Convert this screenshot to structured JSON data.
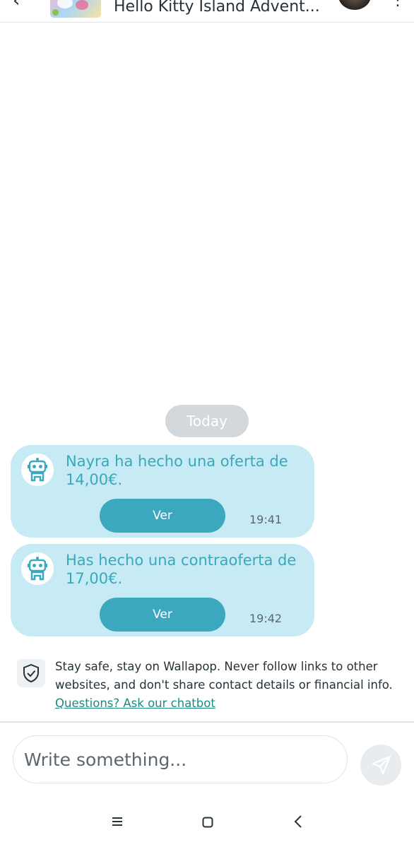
{
  "header": {
    "back_icon": "back-arrow-icon",
    "title": "Hello Kitty Island Advent...",
    "more_icon": "more-vertical-icon"
  },
  "chat": {
    "date_label": "Today",
    "messages": [
      {
        "text": "Nayra ha hecho una oferta de 14,00€.",
        "button_label": "Ver",
        "time": "19:41",
        "icon": "robot-icon"
      },
      {
        "text": "Has hecho una contraoferta de 17,00€.",
        "button_label": "Ver",
        "time": "19:42",
        "icon": "robot-icon"
      }
    ]
  },
  "safety": {
    "icon": "shield-check-icon",
    "text": "Stay safe, stay on Wallapop. Never follow links to other websites, and don't share contact details or financial info. ",
    "link": "Questions? Ask our chatbot"
  },
  "composer": {
    "placeholder": "Write something...",
    "send_icon": "send-icon"
  },
  "system_nav": {
    "icons": [
      "menu-icon",
      "home-icon",
      "back-icon"
    ]
  },
  "colors": {
    "bubble": "#c7ebf4",
    "bubble_text": "#38a8bd",
    "button": "#3ba8bf",
    "link": "#1a8b82"
  }
}
